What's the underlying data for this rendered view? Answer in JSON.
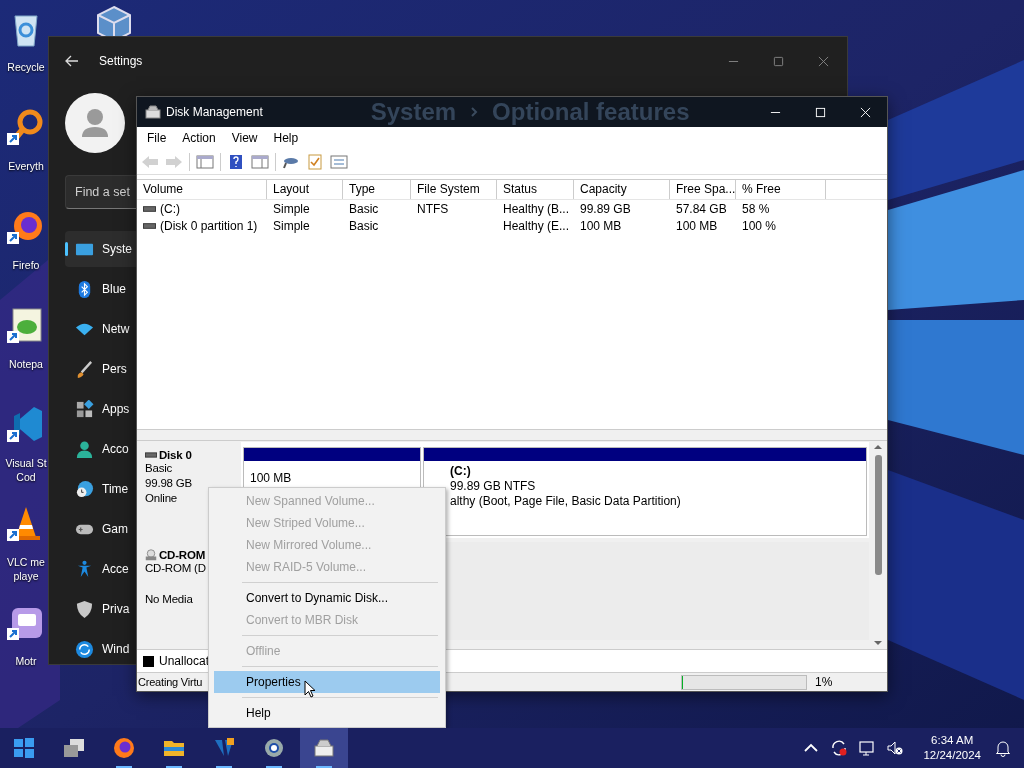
{
  "desktop_icons": [
    {
      "kind": "recycle",
      "shortcut": false,
      "lines": [
        "Recycle"
      ]
    },
    {
      "kind": "everything",
      "shortcut": true,
      "lines": [
        "Everyth"
      ]
    },
    {
      "kind": "firefox",
      "shortcut": true,
      "lines": [
        "Firefo"
      ]
    },
    {
      "kind": "notepad",
      "shortcut": true,
      "lines": [
        "Notepa"
      ]
    },
    {
      "kind": "vscode",
      "shortcut": true,
      "lines": [
        "Visual St",
        "Cod"
      ]
    },
    {
      "kind": "vlc",
      "shortcut": true,
      "lines": [
        "VLC me",
        "playe"
      ]
    },
    {
      "kind": "motrix",
      "shortcut": true,
      "lines": [
        "Motr"
      ]
    }
  ],
  "desktop_icons_2": [
    {
      "kind": "virtualbox"
    }
  ],
  "settings": {
    "title": "Settings",
    "search": {
      "placeholder": "Find a set"
    },
    "breadcrumb": [
      "System",
      "Optional features"
    ],
    "nav": [
      {
        "kind": "system",
        "label": "Syste",
        "selected": true
      },
      {
        "kind": "bluetooth",
        "label": "Blue",
        "selected": false
      },
      {
        "kind": "network",
        "label": "Netw",
        "selected": false
      },
      {
        "kind": "personalization",
        "label": "Pers",
        "selected": false
      },
      {
        "kind": "apps",
        "label": "Apps",
        "selected": false
      },
      {
        "kind": "accounts",
        "label": "Acco",
        "selected": false
      },
      {
        "kind": "time",
        "label": "Time",
        "selected": false
      },
      {
        "kind": "gaming",
        "label": "Gam",
        "selected": false
      },
      {
        "kind": "accessibility",
        "label": "Acce",
        "selected": false
      },
      {
        "kind": "privacy",
        "label": "Priva",
        "selected": false
      },
      {
        "kind": "update",
        "label": "Wind",
        "selected": false
      }
    ]
  },
  "disk_management": {
    "title": "Disk Management",
    "menu": [
      "File",
      "Action",
      "View",
      "Help"
    ],
    "toolbar": [
      {
        "kind": "back",
        "disabled": true
      },
      {
        "kind": "forward",
        "disabled": true
      },
      {
        "kind": "separator"
      },
      {
        "kind": "console",
        "disabled": false
      },
      {
        "kind": "separator"
      },
      {
        "kind": "help",
        "disabled": false
      },
      {
        "kind": "panel",
        "disabled": false
      },
      {
        "kind": "separator"
      },
      {
        "kind": "rescan",
        "disabled": false
      },
      {
        "kind": "check",
        "disabled": false
      },
      {
        "kind": "list",
        "disabled": false
      }
    ],
    "volumes": {
      "columns": [
        "Volume",
        "Layout",
        "Type",
        "File System",
        "Status",
        "Capacity",
        "Free Spa...",
        "% Free"
      ],
      "rows": [
        {
          "cells": [
            "(C:)",
            "Simple",
            "Basic",
            "NTFS",
            "Healthy (B...",
            "99.89 GB",
            "57.84 GB",
            "58 %"
          ]
        },
        {
          "cells": [
            "(Disk 0 partition 1)",
            "Simple",
            "Basic",
            null,
            "Healthy (E...",
            "100 MB",
            "100 MB",
            "100 %"
          ]
        }
      ]
    },
    "disks": [
      {
        "kind": "disk",
        "name": "Disk 0",
        "lines": [
          "Basic",
          "99.98 GB",
          "Online"
        ],
        "partitions": [
          {
            "lines": [
              "100 MB"
            ]
          },
          {
            "title": "(C:)",
            "lines": [
              "99.89 GB NTFS",
              "althy (Boot, Page File, Basic Data Partition)"
            ]
          }
        ]
      },
      {
        "kind": "cdrom",
        "name": "CD-ROM",
        "lines": [
          "CD-ROM (D",
          "No Media"
        ]
      }
    ],
    "legend": [
      {
        "label": "Unallocat",
        "color": "#000000"
      }
    ],
    "status_bar": {
      "text": "Creating Virtu",
      "progress": {
        "level": 0.01
      },
      "percent": "1%"
    }
  },
  "context_menu": [
    {
      "kind": "item",
      "label": "New Spanned Volume...",
      "disabled": true,
      "selected": false
    },
    {
      "kind": "item",
      "label": "New Striped Volume...",
      "disabled": true,
      "selected": false
    },
    {
      "kind": "item",
      "label": "New Mirrored Volume...",
      "disabled": true,
      "selected": false
    },
    {
      "kind": "item",
      "label": "New RAID-5 Volume...",
      "disabled": true,
      "selected": false
    },
    {
      "kind": "separator"
    },
    {
      "kind": "item",
      "label": "Convert to Dynamic Disk...",
      "disabled": false,
      "selected": false
    },
    {
      "kind": "item",
      "label": "Convert to MBR Disk",
      "disabled": true,
      "selected": false
    },
    {
      "kind": "separator"
    },
    {
      "kind": "item",
      "label": "Offline",
      "disabled": true,
      "selected": false
    },
    {
      "kind": "separator"
    },
    {
      "kind": "item",
      "label": "Properties",
      "disabled": false,
      "selected": true
    },
    {
      "kind": "separator"
    },
    {
      "kind": "item",
      "label": "Help",
      "disabled": false,
      "selected": false
    }
  ],
  "taskbar": {
    "apps": [
      {
        "kind": "start",
        "running": false,
        "selected": false
      },
      {
        "kind": "taskview",
        "running": false,
        "selected": false
      },
      {
        "kind": "firefox",
        "running": true,
        "selected": false
      },
      {
        "kind": "explorer",
        "running": true,
        "selected": false
      },
      {
        "kind": "virtualbox",
        "running": true,
        "selected": false
      },
      {
        "kind": "settings",
        "running": true,
        "selected": false
      },
      {
        "kind": "diskmgmt",
        "running": true,
        "selected": true
      }
    ],
    "tray": {
      "time": "6:34 AM",
      "date": "12/24/2024"
    }
  }
}
